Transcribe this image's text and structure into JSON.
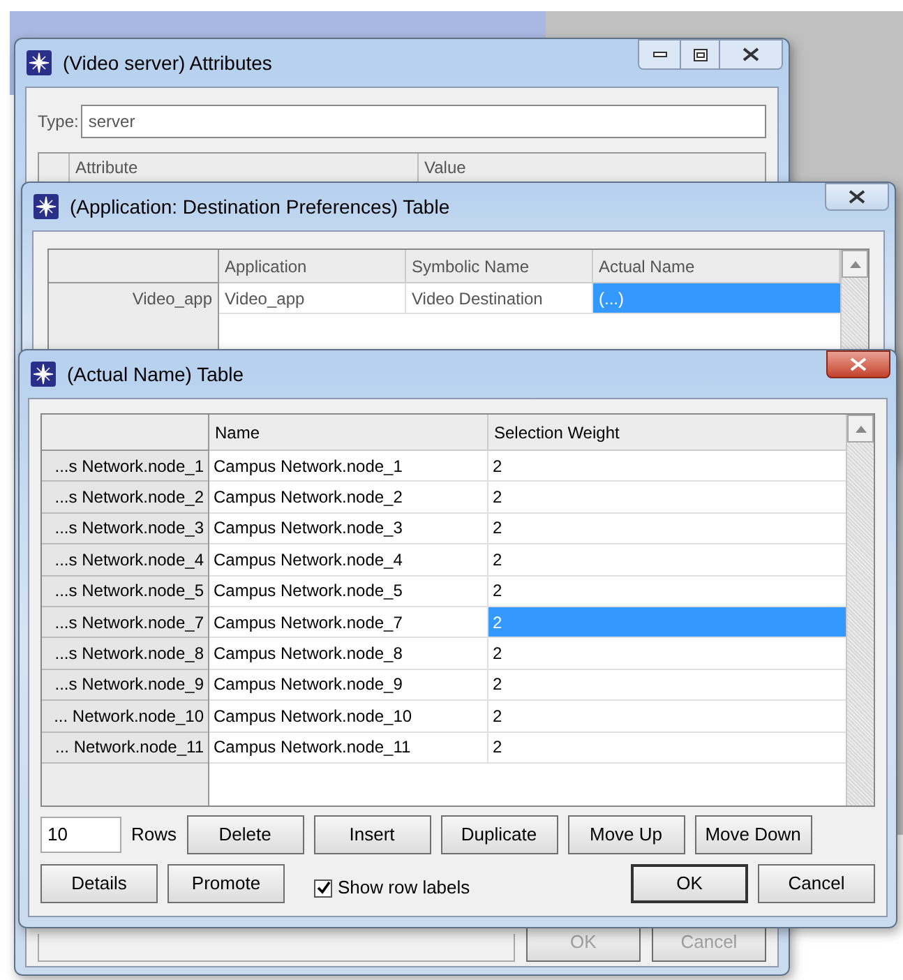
{
  "attributes_window": {
    "title": "(Video server) Attributes",
    "type_label": "Type:",
    "type_value": "server",
    "columns": [
      "Attribute",
      "Value"
    ],
    "buttons": [
      {
        "label": "OK",
        "disabled": true
      },
      {
        "label": "Cancel",
        "disabled": true
      }
    ]
  },
  "preferences_window": {
    "title": "(Application: Destination Preferences) Table",
    "columns": [
      "Application",
      "Symbolic Name",
      "Actual Name"
    ],
    "rows": [
      {
        "label": "Video_app",
        "application": "Video_app",
        "symbolic_name": "Video Destination",
        "actual_name": "(...)",
        "selected": true
      }
    ]
  },
  "actual_name_window": {
    "title": "(Actual Name) Table",
    "columns": [
      "Name",
      "Selection Weight"
    ],
    "rows": [
      {
        "label": "...s Network.node_1",
        "name": "Campus Network.node_1",
        "weight": "2",
        "selected": false
      },
      {
        "label": "...s Network.node_2",
        "name": "Campus Network.node_2",
        "weight": "2",
        "selected": false
      },
      {
        "label": "...s Network.node_3",
        "name": "Campus Network.node_3",
        "weight": "2",
        "selected": false
      },
      {
        "label": "...s Network.node_4",
        "name": "Campus Network.node_4",
        "weight": "2",
        "selected": false
      },
      {
        "label": "...s Network.node_5",
        "name": "Campus Network.node_5",
        "weight": "2",
        "selected": false
      },
      {
        "label": "...s Network.node_7",
        "name": "Campus Network.node_7",
        "weight": "2",
        "selected": true
      },
      {
        "label": "...s Network.node_8",
        "name": "Campus Network.node_8",
        "weight": "2",
        "selected": false
      },
      {
        "label": "...s Network.node_9",
        "name": "Campus Network.node_9",
        "weight": "2",
        "selected": false
      },
      {
        "label": "... Network.node_10",
        "name": "Campus Network.node_10",
        "weight": "2",
        "selected": false
      },
      {
        "label": "... Network.node_11",
        "name": "Campus Network.node_11",
        "weight": "2",
        "selected": false
      }
    ],
    "rows_count": "10",
    "rows_label": "Rows",
    "row_buttons": [
      "Delete",
      "Insert",
      "Duplicate",
      "Move Up",
      "Move Down"
    ],
    "left_buttons": [
      "Details",
      "Promote"
    ],
    "show_row_labels": {
      "label": "Show row labels",
      "checked": true
    },
    "dialog_buttons": [
      {
        "label": "OK",
        "default": true
      },
      {
        "label": "Cancel",
        "default": false
      }
    ]
  }
}
